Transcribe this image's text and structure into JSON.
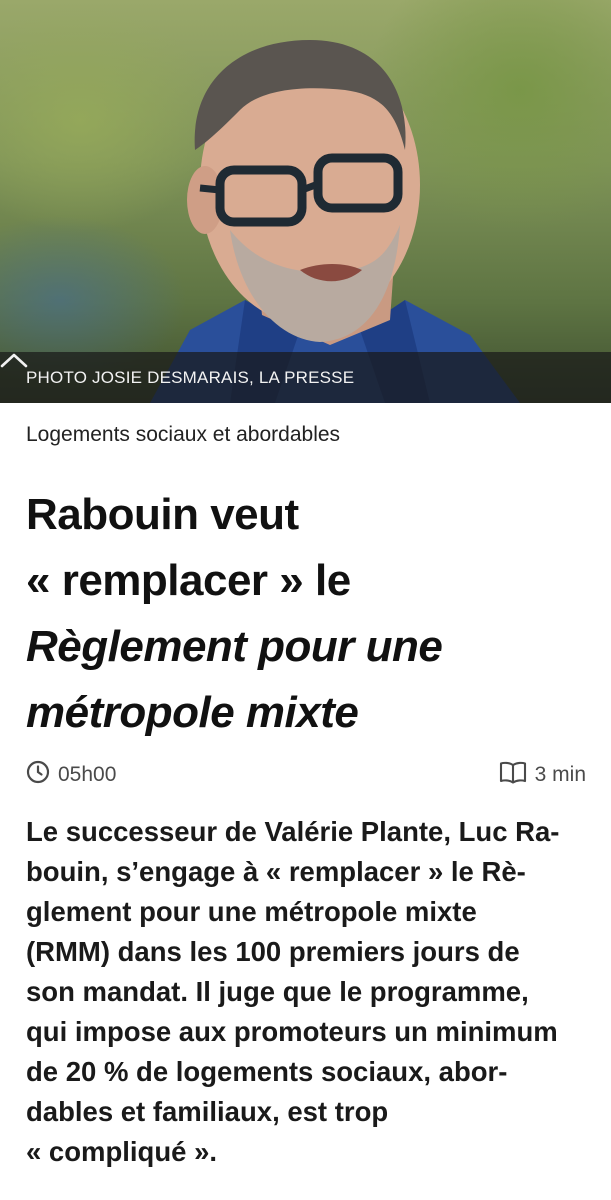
{
  "photo": {
    "caption": "PHOTO JOSIE DESMARAIS, LA PRESSE",
    "toggle_icon": "chevron-up-icon"
  },
  "article": {
    "section": "Logements sociaux et abordables",
    "headline": {
      "line1": "Rabouin veut",
      "line2": "« remplacer » le",
      "line3_italic": "Règlement pour une",
      "line4_italic": "métropole mixte"
    },
    "time": "05h00",
    "time_icon": "clock-icon",
    "reading_time": "3 min",
    "reading_icon": "book-icon",
    "lede_lines": [
      "Le successeur de Valérie Plante, Luc Ra-",
      "bouin, s’engage à « remplacer » le Rè-",
      "glement pour une métropole mixte",
      "(RMM) dans les 100 premiers jours de",
      "son mandat. Il juge que le programme,",
      "qui impose aux promoteurs un minimum",
      "de 20 % de logements sociaux, abor-",
      "dables et familiaux, est trop",
      "« compliqué »."
    ]
  }
}
